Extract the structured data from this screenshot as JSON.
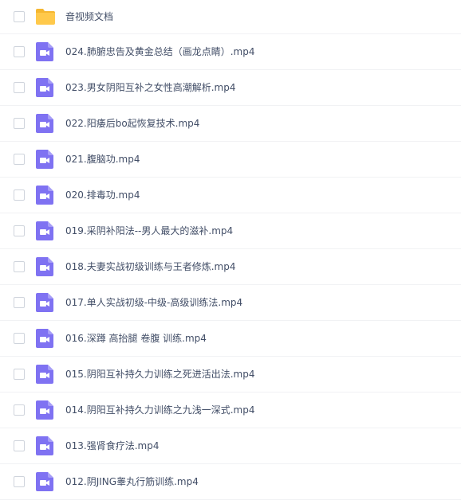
{
  "colors": {
    "folder": "#ffc94b",
    "folder_tab": "#f5b731",
    "video_icon": "#7f72f2",
    "text": "#424e67"
  },
  "items": [
    {
      "name": "音视频文档",
      "type": "folder",
      "icon": "folder-icon"
    },
    {
      "name": "024.肺腑忠告及黄金总结（画龙点睛）.mp4",
      "type": "video",
      "icon": "video-file-icon"
    },
    {
      "name": "023.男女阴阳互补之女性高潮解析.mp4",
      "type": "video",
      "icon": "video-file-icon"
    },
    {
      "name": "022.阳痿后bo起恢复技术.mp4",
      "type": "video",
      "icon": "video-file-icon"
    },
    {
      "name": "021.腹脑功.mp4",
      "type": "video",
      "icon": "video-file-icon"
    },
    {
      "name": "020.排毒功.mp4",
      "type": "video",
      "icon": "video-file-icon"
    },
    {
      "name": "019.采阴补阳法--男人最大的滋补.mp4",
      "type": "video",
      "icon": "video-file-icon"
    },
    {
      "name": "018.夫妻实战初级训练与王者修炼.mp4",
      "type": "video",
      "icon": "video-file-icon"
    },
    {
      "name": "017.单人实战初级-中级-高级训练法.mp4",
      "type": "video",
      "icon": "video-file-icon"
    },
    {
      "name": "016.深蹲 高抬腿 卷腹 训练.mp4",
      "type": "video",
      "icon": "video-file-icon"
    },
    {
      "name": "015.阴阳互补持久力训练之死进活出法.mp4",
      "type": "video",
      "icon": "video-file-icon"
    },
    {
      "name": "014.阴阳互补持久力训练之九浅一深式.mp4",
      "type": "video",
      "icon": "video-file-icon"
    },
    {
      "name": "013.强肾食疗法.mp4",
      "type": "video",
      "icon": "video-file-icon"
    },
    {
      "name": "012.阴JING睾丸行筋训练.mp4",
      "type": "video",
      "icon": "video-file-icon"
    }
  ]
}
